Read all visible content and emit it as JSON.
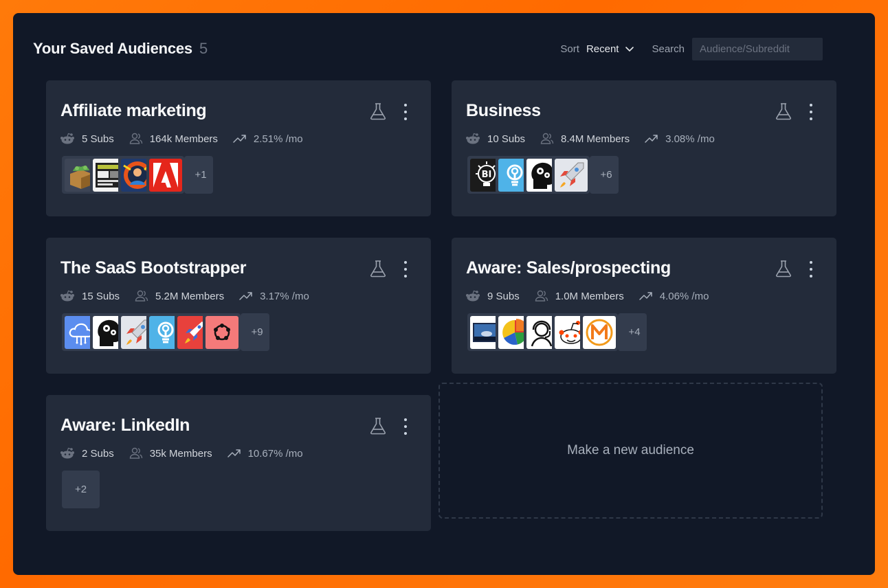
{
  "header": {
    "title": "Your Saved Audiences",
    "count": "5",
    "sort_label": "Sort",
    "sort_value": "Recent",
    "search_label": "Search",
    "search_placeholder": "Audience/Subreddit"
  },
  "audiences": [
    {
      "name": "Affiliate marketing",
      "subs": "5 Subs",
      "members": "164k Members",
      "growth": "2.51% /mo",
      "more": "+1"
    },
    {
      "name": "Business",
      "subs": "10 Subs",
      "members": "8.4M Members",
      "growth": "3.08% /mo",
      "more": "+6"
    },
    {
      "name": "The SaaS Bootstrapper",
      "subs": "15 Subs",
      "members": "5.2M Members",
      "growth": "3.17% /mo",
      "more": "+9"
    },
    {
      "name": "Aware: Sales/prospecting",
      "subs": "9 Subs",
      "members": "1.0M Members",
      "growth": "4.06% /mo",
      "more": "+4"
    },
    {
      "name": "Aware: LinkedIn",
      "subs": "2 Subs",
      "members": "35k Members",
      "growth": "10.67% /mo",
      "more": "+2"
    }
  ],
  "new_audience_label": "Make a new audience",
  "colors": {
    "background_gradient": "#ff7a0a",
    "panel": "#111827",
    "card": "#232b3a",
    "thumb_bg": "#333c4d"
  },
  "thumbnail_icons": {
    "affiliate": [
      "money-box-icon",
      "website-screenshot-icon",
      "colorful-portrait-icon",
      "adobe-icon"
    ],
    "business": [
      "bi-lightbulb-icon",
      "blue-lightbulb-icon",
      "head-gears-icon",
      "rocket-icon"
    ],
    "saas": [
      "cloud-icon",
      "head-gears-icon",
      "rocket-icon",
      "blue-lightbulb-icon",
      "red-rocket-icon",
      "pink-network-icon"
    ],
    "sales": [
      "photo-icon",
      "pie-chart-icon",
      "headset-agent-icon",
      "reddit-alien-icon",
      "m-logo-icon"
    ]
  }
}
